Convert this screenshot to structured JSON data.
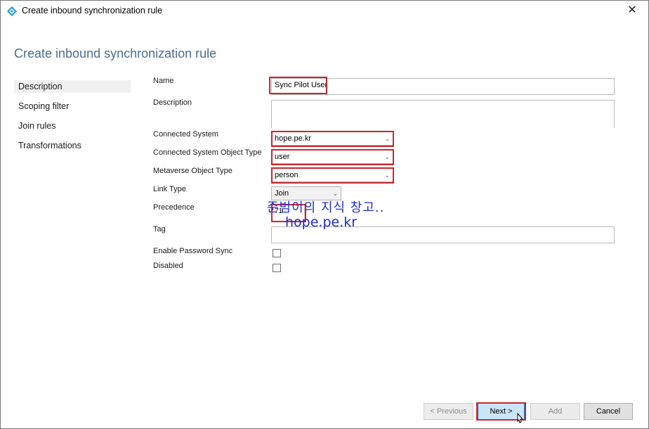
{
  "window": {
    "title": "Create inbound synchronization rule",
    "close_symbol": "✕"
  },
  "page": {
    "title": "Create inbound synchronization rule"
  },
  "nav": {
    "items": [
      "Description",
      "Scoping filter",
      "Join rules",
      "Transformations"
    ]
  },
  "form": {
    "name_label": "Name",
    "name_value": "Sync Pilot User",
    "description_label": "Description",
    "description_value": "",
    "connected_system_label": "Connected System",
    "connected_system_value": "hope.pe.kr",
    "cs_object_type_label": "Connected System Object Type",
    "cs_object_type_value": "user",
    "mv_object_type_label": "Metaverse Object Type",
    "mv_object_type_value": "person",
    "link_type_label": "Link Type",
    "link_type_value": "Join",
    "precedence_label": "Precedence",
    "precedence_value": "71",
    "tag_label": "Tag",
    "tag_value": "",
    "enable_password_sync_label": "Enable Password Sync",
    "disabled_label": "Disabled"
  },
  "watermark": {
    "line1": "준범이의 지식 창고..",
    "line2": "hope.pe.kr",
    "color": "#1f2fc8"
  },
  "buttons": {
    "previous": "< Previous",
    "next": "Next >",
    "add": "Add",
    "cancel": "Cancel"
  },
  "colors": {
    "highlight": "#c8272f",
    "title": "#4c6e8e",
    "accent": "#0078d7"
  }
}
